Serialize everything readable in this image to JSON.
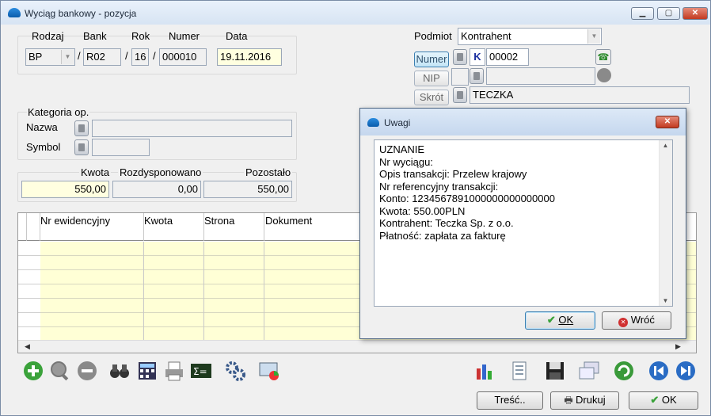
{
  "window": {
    "title": "Wyciąg bankowy - pozycja",
    "controls": {
      "minimize": "▁",
      "maximize": "▢",
      "close": "✕"
    }
  },
  "document": {
    "labels": {
      "rodzaj": "Rodzaj",
      "bank": "Bank",
      "rok": "Rok",
      "numer": "Numer",
      "data": "Data"
    },
    "rodzaj_value": "BP",
    "separator": "/",
    "bank_value": "R02",
    "rok_value": "16",
    "numer_value": "000010",
    "data_value": "19.11.2016"
  },
  "podmiot": {
    "label": "Podmiot",
    "type_value": "Kontrahent",
    "numer_button": "Numer",
    "nip_button": "NIP",
    "skrot_button": "Skrót",
    "kind_letter": "K",
    "number_value": "00002",
    "nip_value": "",
    "skrot_value": "TECZKA"
  },
  "kategoria": {
    "title": "Kategoria op.",
    "nazwa_label": "Nazwa",
    "symbol_label": "Symbol",
    "nazwa_value": "",
    "symbol_value": ""
  },
  "amounts": {
    "kwota_label": "Kwota",
    "rozdysponowano_label": "Rozdysponowano",
    "pozostalo_label": "Pozostało",
    "kwota_value": "550,00",
    "rozdysponowano_value": "0,00",
    "pozostalo_value": "550,00"
  },
  "table": {
    "columns": [
      "Nr ewidencyjny",
      "Kwota",
      "Strona",
      "Dokument"
    ],
    "rows": 7
  },
  "toolbar": {
    "icons": [
      "add-icon",
      "zoom-icon",
      "remove-icon",
      "binoculars-icon",
      "calculator-icon",
      "printer-icon",
      "sum-icon",
      "settings-icon",
      "monitor-icon",
      "chart-icon",
      "document-icon",
      "save-icon",
      "windows-icon",
      "refresh-icon",
      "prev-icon",
      "next-icon"
    ]
  },
  "buttons": {
    "tresc": "Treść..",
    "drukuj": "Drukuj",
    "ok": "OK"
  },
  "dialog": {
    "title": "Uwagi",
    "lines": [
      "UZNANIE",
      "Nr wyciągu:",
      "Opis transakcji: Przelew krajowy",
      "Nr referencyjny transakcji:",
      "Konto: 1234567891000000000000000",
      "Kwota: 550.00PLN",
      "Kontrahent: Teczka Sp. z o.o.",
      "Płatność: zapłata za fakturę"
    ],
    "ok_button": "OK",
    "back_button": "Wróć"
  },
  "colors": {
    "accent": "#3c7fb1",
    "highlight_field": "#ffffe0",
    "grid_row": "#ffffd6",
    "ok_check": "#3aa23a",
    "back_icon": "#d03030"
  }
}
